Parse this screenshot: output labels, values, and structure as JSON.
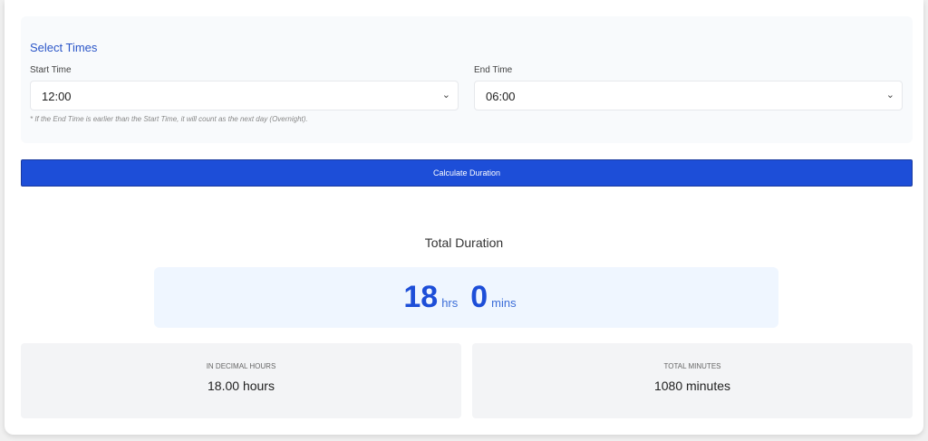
{
  "section_title": "Select Times",
  "start": {
    "label": "Start Time",
    "value": "12:00"
  },
  "end": {
    "label": "End Time",
    "value": "06:00"
  },
  "note": "* If the End Time is earlier than the Start Time, it will count as the next day (Overnight).",
  "button": "Calculate Duration",
  "result": {
    "heading": "Total Duration",
    "hours": "18",
    "hours_unit": "hrs",
    "minutes": "0",
    "minutes_unit": "mins"
  },
  "stats": [
    {
      "label": "In Decimal Hours",
      "value": "18.00 hours"
    },
    {
      "label": "Total Minutes",
      "value": "1080 minutes"
    }
  ],
  "colors": {
    "accent": "#1d4ed8"
  }
}
